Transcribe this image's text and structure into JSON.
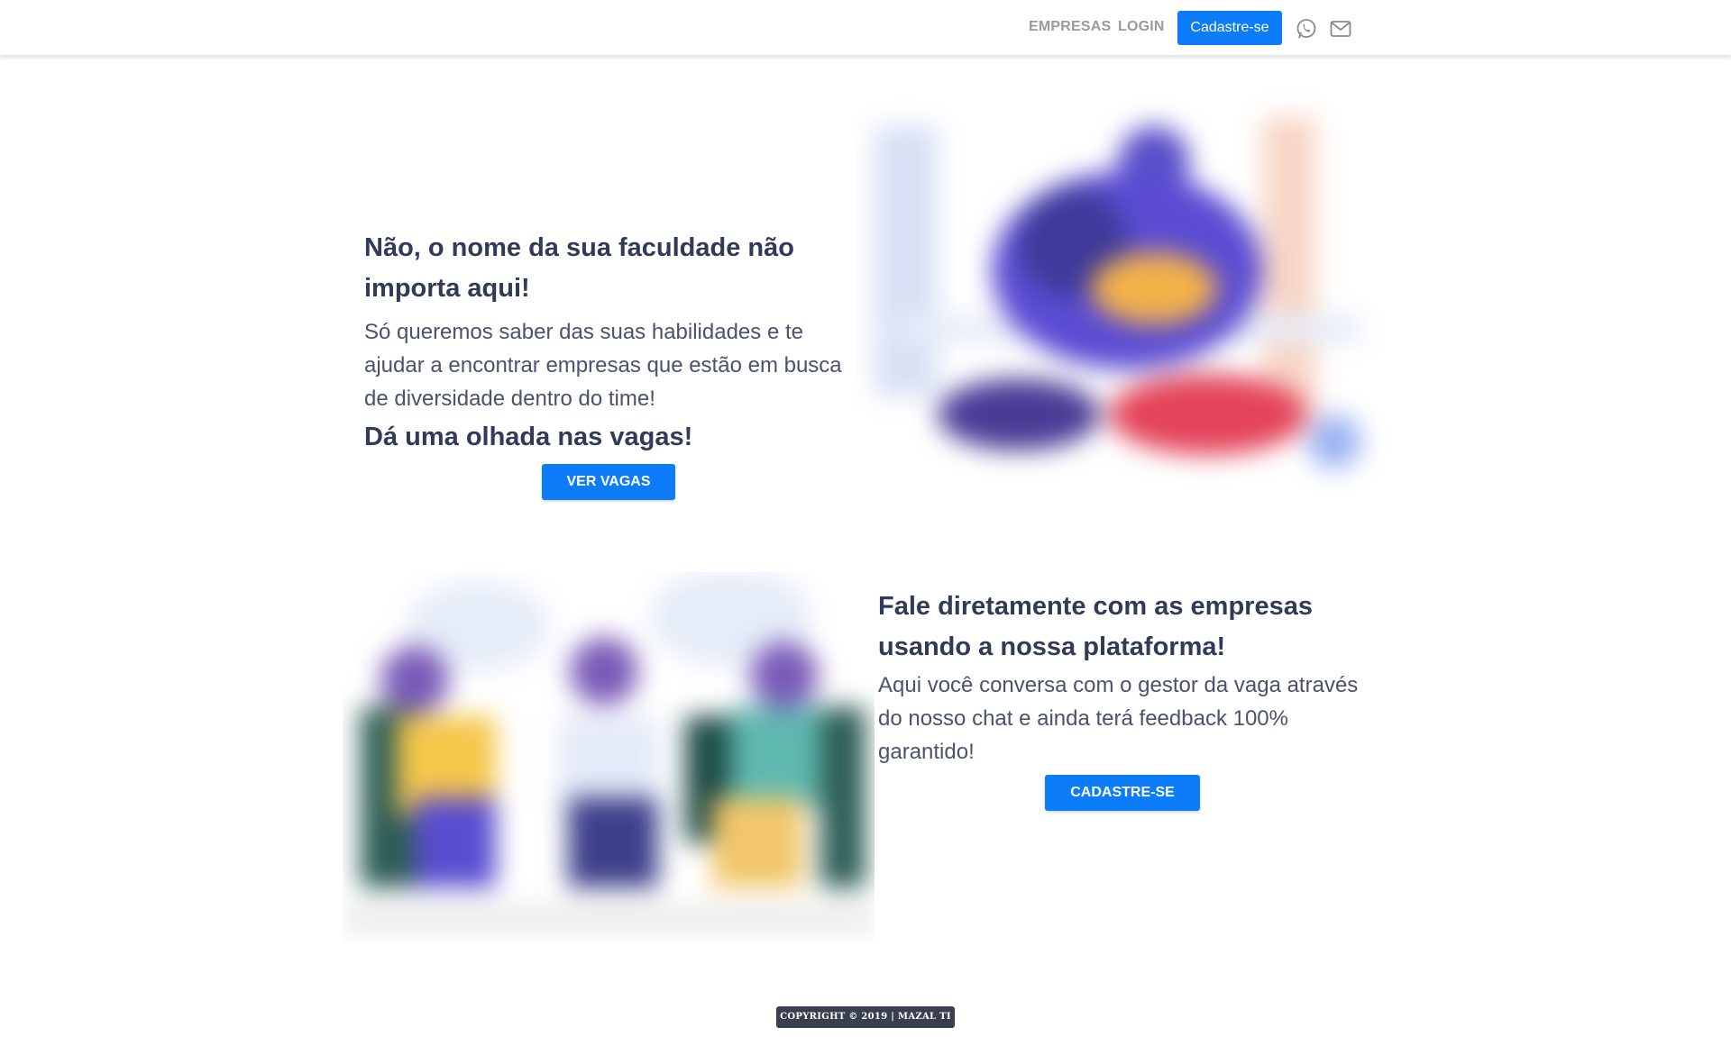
{
  "nav": {
    "links": [
      {
        "label": "EMPRESAS"
      },
      {
        "label": "LOGIN"
      }
    ],
    "cta_label": "Cadastre-se",
    "icons": [
      "whatsapp-icon",
      "mail-icon"
    ]
  },
  "hero": {
    "title": "Não, o nome da sua faculdade não importa aqui!",
    "text": "Só queremos saber das suas habilidades e te ajudar a encontrar empresas que estão em busca de diversidade dentro do time!",
    "subtitle": "Dá uma olhada nas vagas!",
    "button_label": "VER VAGAS"
  },
  "chat": {
    "title": "Fale diretamente com as empresas usando a nossa plataforma!",
    "text": "Aqui você conversa com o gestor da vaga através do nosso chat e ainda terá feedback 100% garantido!",
    "button_label": "CADASTRE-SE"
  },
  "footer": {
    "copyright": "COPYRIGHT © 2019 | MAZAL TI"
  },
  "colors": {
    "primary": "#0d7cf8",
    "heading": "#323a5a",
    "footer_bg": "#3a3f4d"
  }
}
